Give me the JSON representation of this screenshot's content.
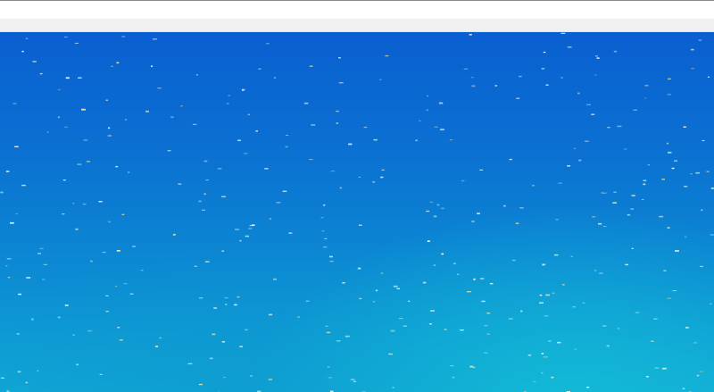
{
  "top_bar": {},
  "status_strip": {},
  "desktop": {
    "background": "blue-cyan-starfield",
    "colors": {
      "top": "#0a5fd0",
      "middle": "#0b72d2",
      "bottom": "#10a9d6",
      "glow": "#14bed7",
      "specks": [
        "#ffffff",
        "#d8f6ff",
        "#ffe9a6",
        "#a8f0ff"
      ]
    }
  }
}
